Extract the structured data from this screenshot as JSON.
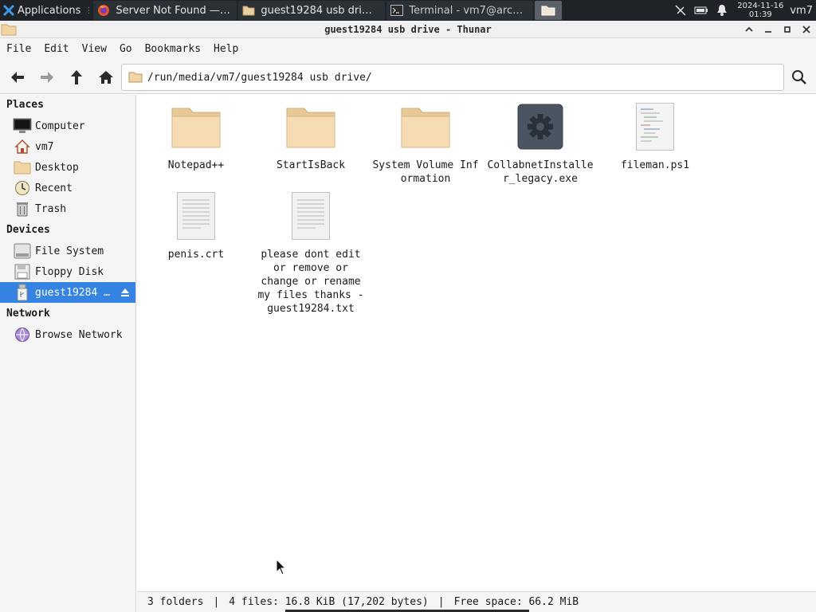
{
  "taskbar": {
    "applications_label": "Applications",
    "tasks": [
      {
        "label": "Server Not Found —…",
        "icon": "firefox-icon"
      },
      {
        "label": "guest19284 usb dri…",
        "icon": "folder-icon"
      },
      {
        "label": "Terminal - vm7@arc…",
        "icon": "terminal-icon"
      }
    ],
    "clock_date": "2024-11-16",
    "clock_time": "01:39",
    "user": "vm7"
  },
  "window": {
    "title": "guest19284 usb drive - Thunar"
  },
  "menu": {
    "file": "File",
    "edit": "Edit",
    "view": "View",
    "go": "Go",
    "bookmarks": "Bookmarks",
    "help": "Help"
  },
  "toolbar": {
    "location": "/run/media/vm7/guest19284 usb drive/"
  },
  "sidebar": {
    "places_heading": "Places",
    "places": [
      {
        "label": "Computer",
        "icon": "computer-icon"
      },
      {
        "label": "vm7",
        "icon": "home-icon"
      },
      {
        "label": "Desktop",
        "icon": "desktop-folder-icon"
      },
      {
        "label": "Recent",
        "icon": "recent-icon"
      },
      {
        "label": "Trash",
        "icon": "trash-icon"
      }
    ],
    "devices_heading": "Devices",
    "devices": [
      {
        "label": "File System",
        "icon": "drive-icon"
      },
      {
        "label": "Floppy Disk",
        "icon": "floppy-icon"
      },
      {
        "label": "guest19284 usb drive",
        "icon": "usb-drive-icon",
        "selected": true
      }
    ],
    "network_heading": "Network",
    "network": [
      {
        "label": "Browse Network",
        "icon": "network-icon"
      }
    ]
  },
  "files": [
    {
      "name": "Notepad++",
      "type": "folder"
    },
    {
      "name": "StartIsBack",
      "type": "folder"
    },
    {
      "name": "System Volume Information",
      "type": "folder"
    },
    {
      "name": "CollabnetInstaller_legacy.exe",
      "type": "executable"
    },
    {
      "name": "fileman.ps1",
      "type": "script"
    },
    {
      "name": "penis.crt",
      "type": "text"
    },
    {
      "name": "please dont edit or remove or change or rename my files thanks -guest19284.txt",
      "type": "text"
    }
  ],
  "status": {
    "folders": "3 folders",
    "files": "4 files: 16.8 KiB (17,202 bytes)",
    "free_space": "Free space: 66.2 MiB",
    "separator": "|"
  },
  "colors": {
    "selection": "#3584e4",
    "folder": "#f3d4a4",
    "taskbar": "#1f2327"
  }
}
